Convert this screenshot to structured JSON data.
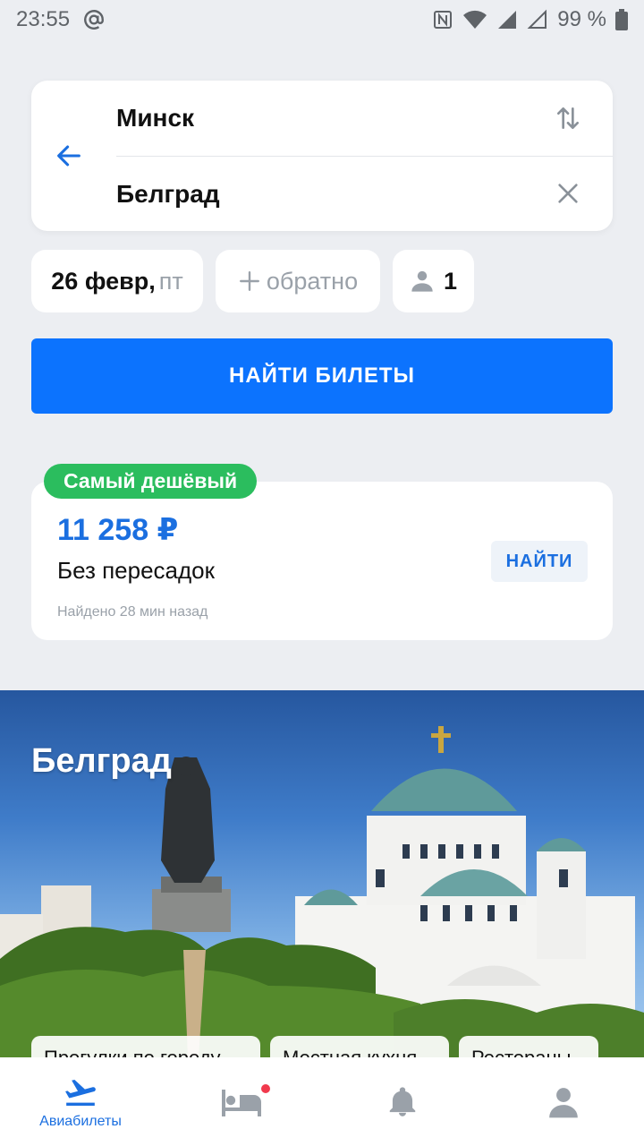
{
  "status_bar": {
    "time": "23:55",
    "battery": "99 %",
    "icons": [
      "at-sign-icon",
      "nfc-icon",
      "wifi-icon",
      "signal-icon",
      "signal-empty-icon",
      "battery-icon"
    ]
  },
  "route": {
    "from": "Минск",
    "to": "Белград",
    "back_icon": "arrow-left-icon",
    "swap_icon": "swap-vertical-icon",
    "clear_icon": "close-icon"
  },
  "filters": {
    "date_main": "26 февр",
    "date_sep": ",",
    "date_day": " пт",
    "return_label": "обратно",
    "passengers": "1"
  },
  "search_button": "НАЙТИ БИЛЕТЫ",
  "offer": {
    "badge": "Самый дешёвый",
    "price": "11 258 ₽",
    "description": "Без пересадок",
    "found": "Найдено 28 мин назад",
    "button": "НАЙТИ"
  },
  "destination": {
    "title": "Белград",
    "tags": [
      "Прогулки по городу",
      "Местная кухня",
      "Рестораны"
    ]
  },
  "bottom_nav": {
    "items": [
      {
        "label": "Авиабилеты",
        "icon": "airplane-icon",
        "active": true
      },
      {
        "label": "",
        "icon": "hotel-bed-icon",
        "badge": true
      },
      {
        "label": "",
        "icon": "bell-icon"
      },
      {
        "label": "",
        "icon": "profile-icon"
      }
    ]
  },
  "colors": {
    "accent": "#0c73fe",
    "price": "#1b6fe0",
    "badge_green": "#2bbd5e",
    "background": "#eceef2",
    "notification": "#f1394d"
  }
}
